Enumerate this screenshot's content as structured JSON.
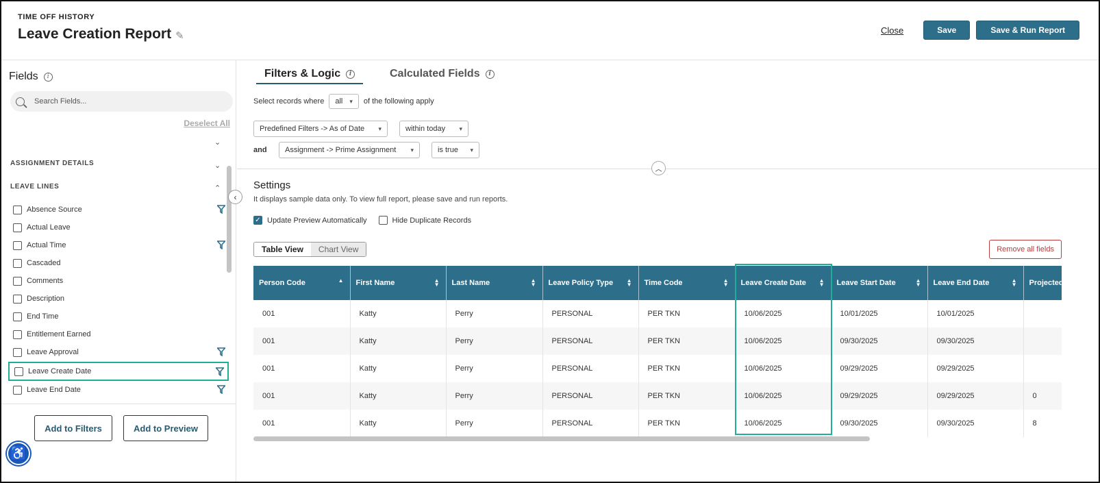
{
  "header": {
    "eyebrow": "TIME OFF HISTORY",
    "title": "Leave Creation Report",
    "close_label": "Close",
    "save_label": "Save",
    "save_run_label": "Save & Run Report"
  },
  "left_panel": {
    "title": "Fields",
    "search_placeholder": "Search Fields...",
    "deselect_label": "Deselect All",
    "sections": [
      "ASSIGNMENT DETAILS",
      "LEAVE LINES"
    ],
    "fields": [
      {
        "label": "Absence Source",
        "filter": true
      },
      {
        "label": "Actual Leave",
        "filter": false
      },
      {
        "label": "Actual Time",
        "filter": true
      },
      {
        "label": "Cascaded",
        "filter": false
      },
      {
        "label": "Comments",
        "filter": false
      },
      {
        "label": "Description",
        "filter": false
      },
      {
        "label": "End Time",
        "filter": false
      },
      {
        "label": "Entitlement Earned",
        "filter": false
      },
      {
        "label": "Leave Approval",
        "filter": true
      },
      {
        "label": "Leave Create Date",
        "filter": true
      },
      {
        "label": "Leave End Date",
        "filter": true
      }
    ],
    "add_filters_label": "Add to Filters",
    "add_preview_label": "Add to Preview"
  },
  "tabs": {
    "filters_logic": "Filters & Logic",
    "calculated_fields": "Calculated Fields"
  },
  "logic": {
    "prefix": "Select records where",
    "mode": "all",
    "suffix": "of the following apply",
    "and_label": "and",
    "filter1_field": "Predefined Filters -> As of Date",
    "filter1_op": "within today",
    "filter2_field": "Assignment -> Prime Assignment",
    "filter2_op": "is true"
  },
  "settings": {
    "title": "Settings",
    "description": "It displays sample data only. To view full report, please save and run reports.",
    "update_preview": "Update Preview Automatically",
    "hide_duplicates": "Hide Duplicate Records",
    "table_view": "Table View",
    "chart_view": "Chart View",
    "remove_all": "Remove all fields"
  },
  "table": {
    "columns": [
      "Person Code",
      "First Name",
      "Last Name",
      "Leave Policy Type",
      "Time Code",
      "Leave Create Date",
      "Leave Start Date",
      "Leave End Date",
      "Projected"
    ],
    "rows": [
      [
        "001",
        "Katty",
        "Perry",
        "PERSONAL",
        "PER TKN",
        "10/06/2025",
        "10/01/2025",
        "10/01/2025",
        ""
      ],
      [
        "001",
        "Katty",
        "Perry",
        "PERSONAL",
        "PER TKN",
        "10/06/2025",
        "09/30/2025",
        "09/30/2025",
        ""
      ],
      [
        "001",
        "Katty",
        "Perry",
        "PERSONAL",
        "PER TKN",
        "10/06/2025",
        "09/29/2025",
        "09/29/2025",
        ""
      ],
      [
        "001",
        "Katty",
        "Perry",
        "PERSONAL",
        "PER TKN",
        "10/06/2025",
        "09/29/2025",
        "09/29/2025",
        "0"
      ],
      [
        "001",
        "Katty",
        "Perry",
        "PERSONAL",
        "PER TKN",
        "10/06/2025",
        "09/30/2025",
        "09/30/2025",
        "8"
      ]
    ]
  },
  "colors": {
    "primary": "#2d6f8a",
    "highlight": "#1fae97",
    "danger": "#b73c3c"
  }
}
